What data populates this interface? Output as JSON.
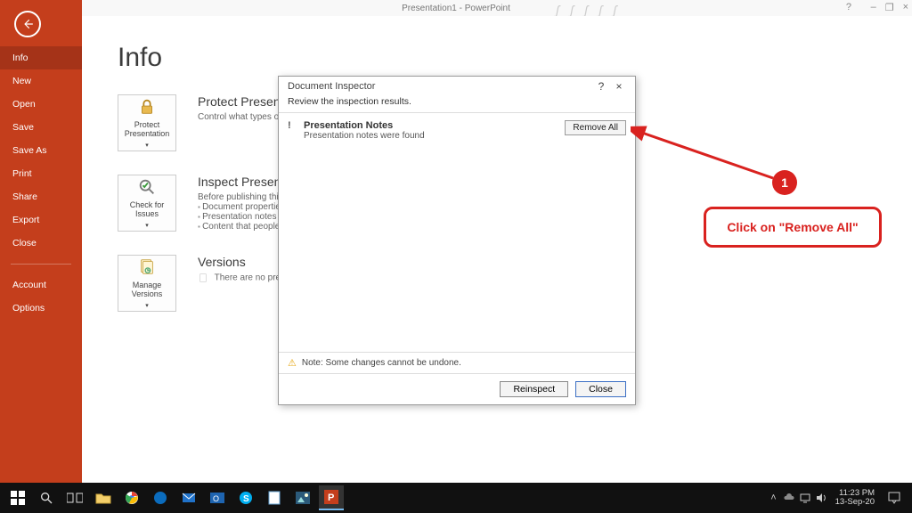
{
  "window": {
    "title": "Presentation1 - PowerPoint",
    "help": "?",
    "minimize": "–",
    "restore": "❐",
    "close": "×"
  },
  "nav": {
    "info": "Info",
    "new": "New",
    "open": "Open",
    "save": "Save",
    "saveas": "Save As",
    "print": "Print",
    "share": "Share",
    "export": "Export",
    "close": "Close",
    "account": "Account",
    "options": "Options"
  },
  "page": {
    "title": "Info",
    "protect": {
      "button": "Protect Presentation",
      "caret": "▾",
      "heading": "Protect Presenta",
      "desc": "Control what types of ch"
    },
    "inspect": {
      "button": "Check for Issues",
      "caret": "▾",
      "heading": "Inspect Presenta",
      "desc": "Before publishing this fil",
      "bul1": "Document propertie",
      "bul2": "Presentation notes",
      "bul3": "Content that people"
    },
    "versions": {
      "button": "Manage Versions",
      "caret": "▾",
      "heading": "Versions",
      "desc": "There are no previou"
    }
  },
  "dialog": {
    "title": "Document Inspector",
    "help": "?",
    "close_x": "×",
    "subtitle": "Review the inspection results.",
    "result_bang": "!",
    "result_title": "Presentation Notes",
    "result_sub": "Presentation notes were found",
    "remove_all": "Remove All",
    "note_icon": "⚠",
    "note_text": "Note: Some changes cannot be undone.",
    "reinspect": "Reinspect",
    "close": "Close"
  },
  "annotation": {
    "number": "1",
    "text": "Click on \"Remove All\""
  },
  "taskbar": {
    "time": "11:23 PM",
    "date": "13-Sep-20",
    "tray_up": "˄"
  }
}
